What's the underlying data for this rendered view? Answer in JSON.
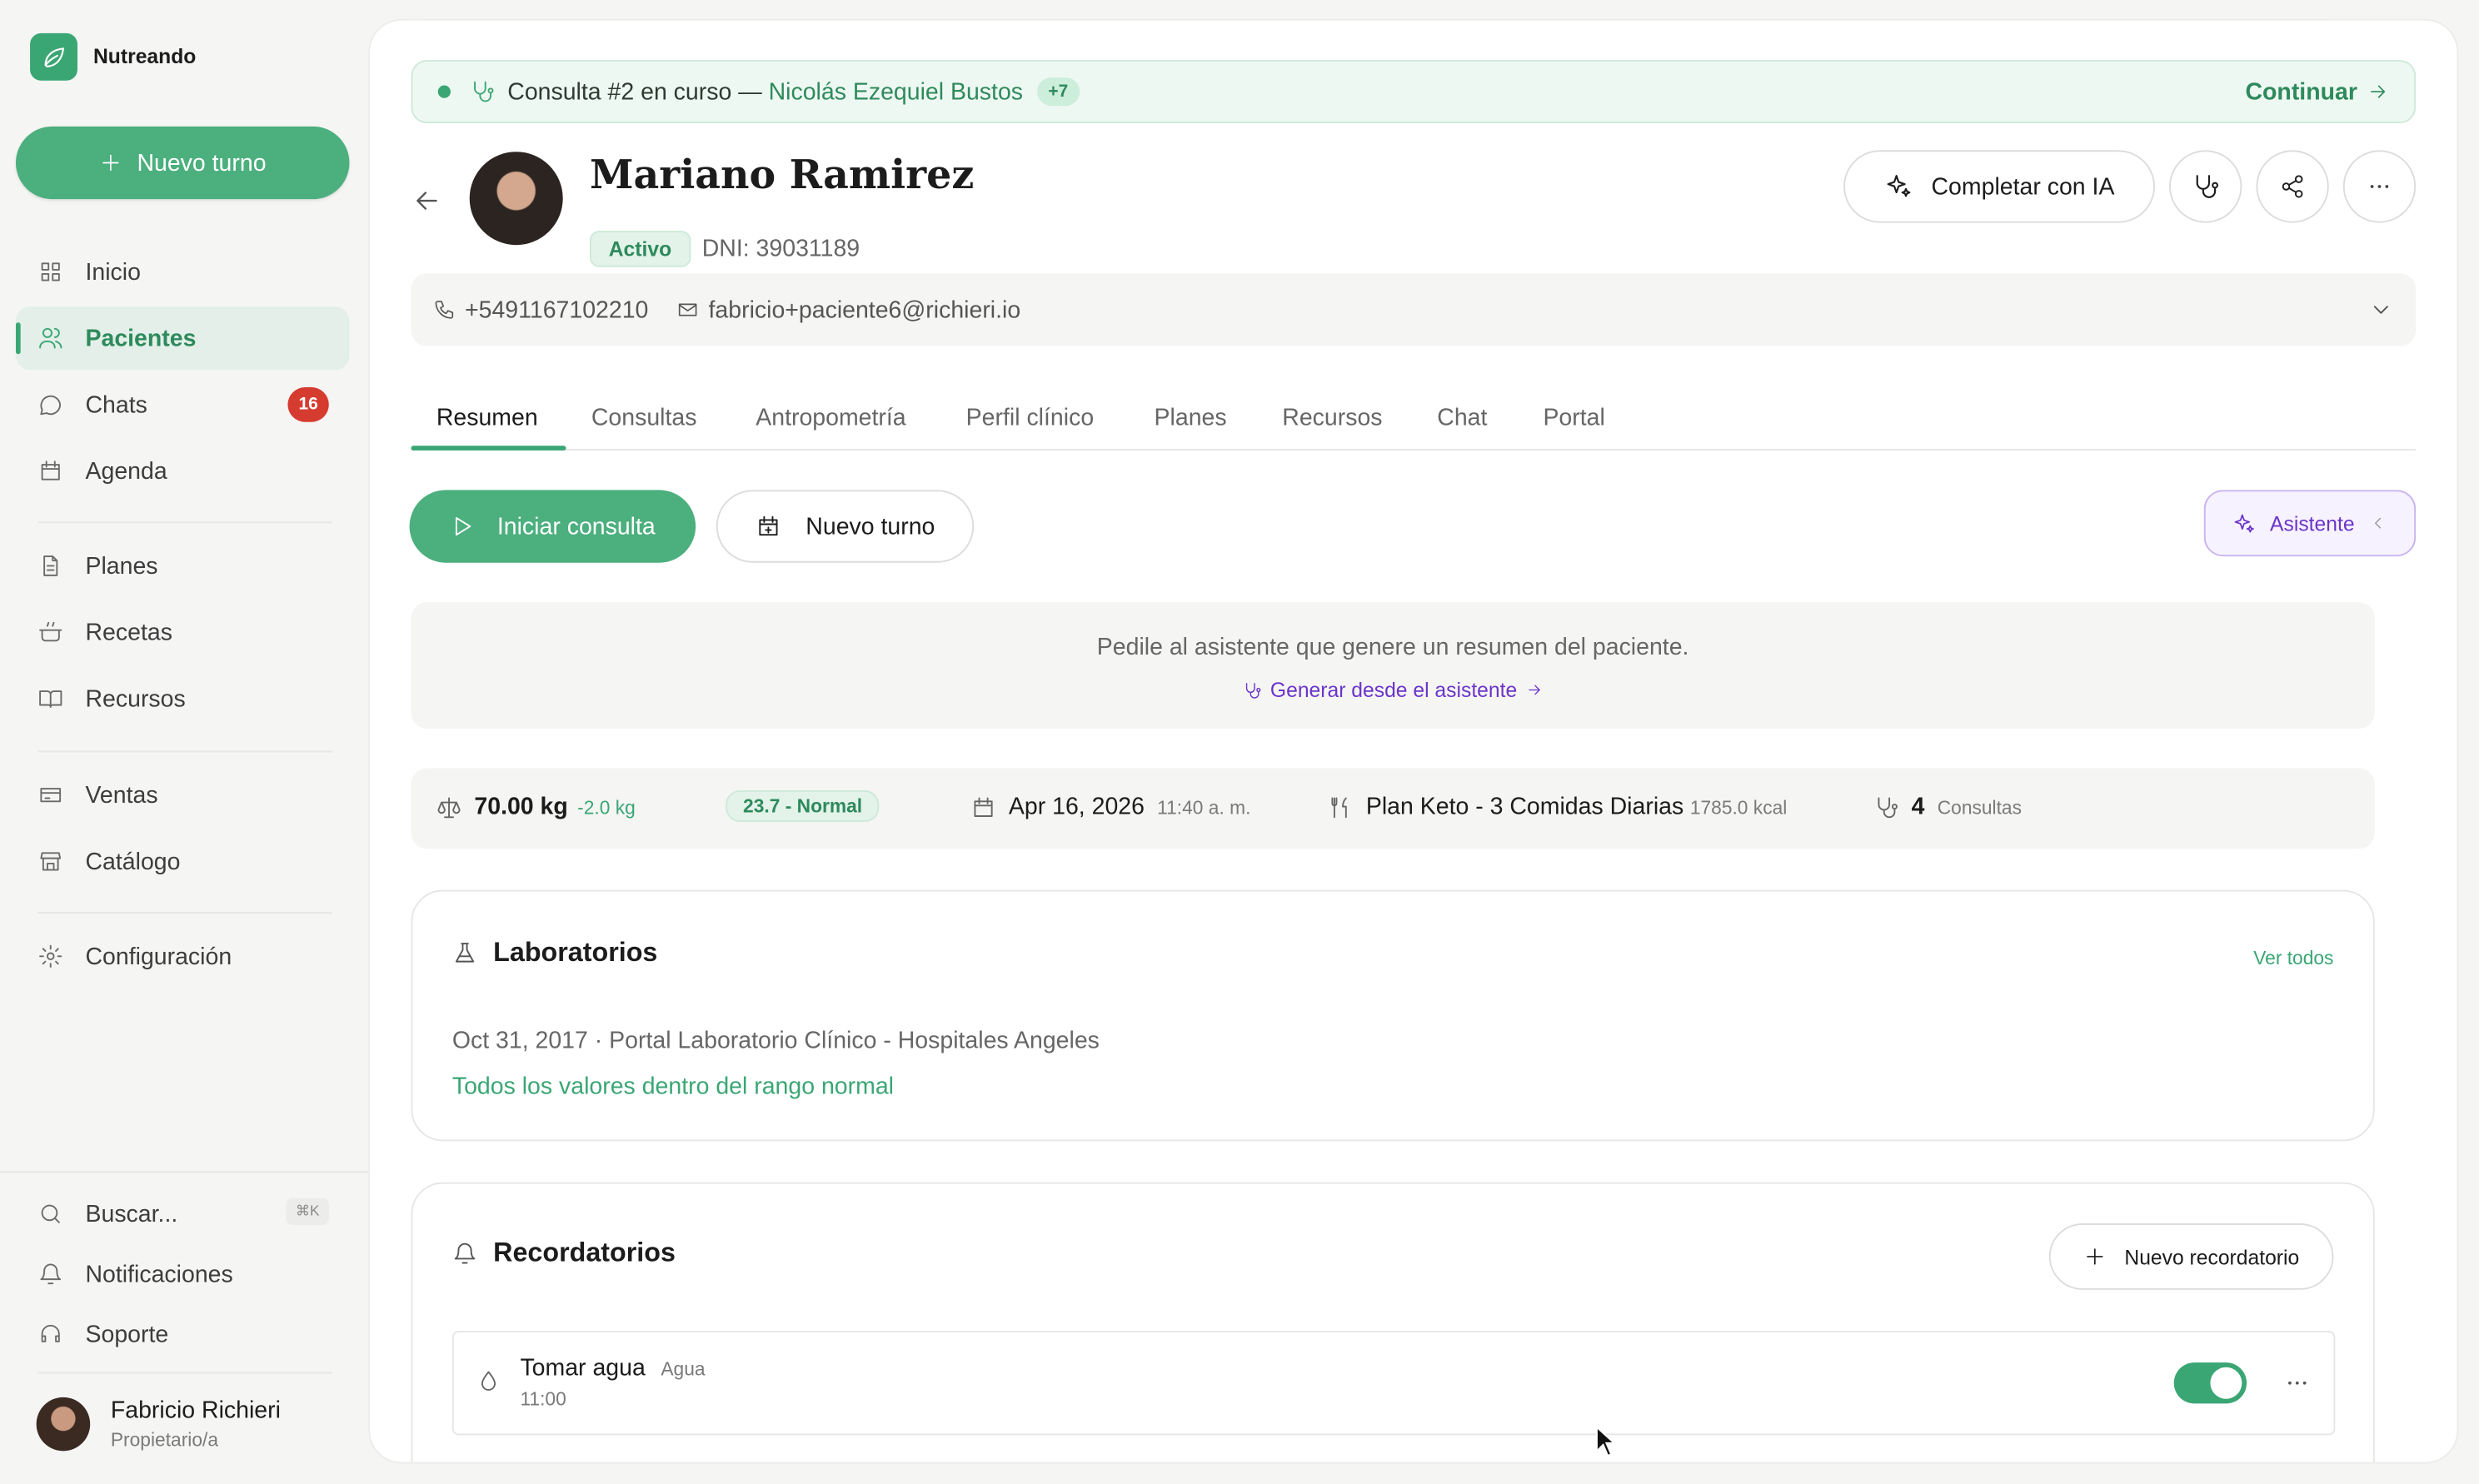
{
  "brand": {
    "name": "Nutreando"
  },
  "sidebar": {
    "new_turn_label": "Nuevo turno",
    "nav": [
      {
        "label": "Inicio"
      },
      {
        "label": "Pacientes"
      },
      {
        "label": "Chats",
        "badge": "16"
      },
      {
        "label": "Agenda"
      },
      {
        "label": "Planes"
      },
      {
        "label": "Recetas"
      },
      {
        "label": "Recursos"
      },
      {
        "label": "Ventas"
      },
      {
        "label": "Catálogo"
      },
      {
        "label": "Configuración"
      }
    ],
    "bottom": [
      {
        "label": "Buscar...",
        "shortcut": "⌘K"
      },
      {
        "label": "Notificaciones"
      },
      {
        "label": "Soporte"
      }
    ],
    "user": {
      "name": "Fabricio Richieri",
      "role": "Propietario/a"
    }
  },
  "banner": {
    "text": "Consulta #2 en curso —",
    "patient": "Nicolás Ezequiel Bustos",
    "count": "+7",
    "continue_label": "Continuar"
  },
  "patient": {
    "name": "Mariano Ramirez",
    "status": "Activo",
    "dni": "DNI: 39031189",
    "phone": "+5491167102210",
    "email": "fabricio+paciente6@richieri.io"
  },
  "header_actions": {
    "complete_ai": "Completar con IA"
  },
  "tabs": [
    "Resumen",
    "Consultas",
    "Antropometría",
    "Perfil clínico",
    "Planes",
    "Recursos",
    "Chat",
    "Portal"
  ],
  "actions": {
    "start": "Iniciar consulta",
    "new_turn": "Nuevo turno",
    "assistant": "Asistente"
  },
  "assistant_box": {
    "text": "Pedile al asistente que genere un resumen del paciente.",
    "link": "Generar desde el asistente"
  },
  "stats": {
    "weight": "70.00 kg",
    "weight_delta": "-2.0 kg",
    "bmi": "23.7 - Normal",
    "date": "Apr 16, 2026",
    "time": "11:40 a. m.",
    "plan": "Plan Keto - 3 Comidas Diarias",
    "kcal": "1785.0 kcal",
    "consults_count": "4",
    "consults_label": "Consultas"
  },
  "labs": {
    "title": "Laboratorios",
    "see_all": "Ver todos",
    "date": "Oct 31, 2017",
    "source": "· Portal Laboratorio Clínico - Hospitales Angeles",
    "result": "Todos los valores dentro del rango normal"
  },
  "reminders": {
    "title": "Recordatorios",
    "new_label": "Nuevo recordatorio",
    "items": [
      {
        "title": "Tomar agua",
        "tag": "Agua",
        "time": "11:00",
        "enabled": true
      }
    ]
  },
  "colors": {
    "accent": "#3aa674",
    "assistant": "#6b35c9",
    "badge": "#d63b2f"
  }
}
